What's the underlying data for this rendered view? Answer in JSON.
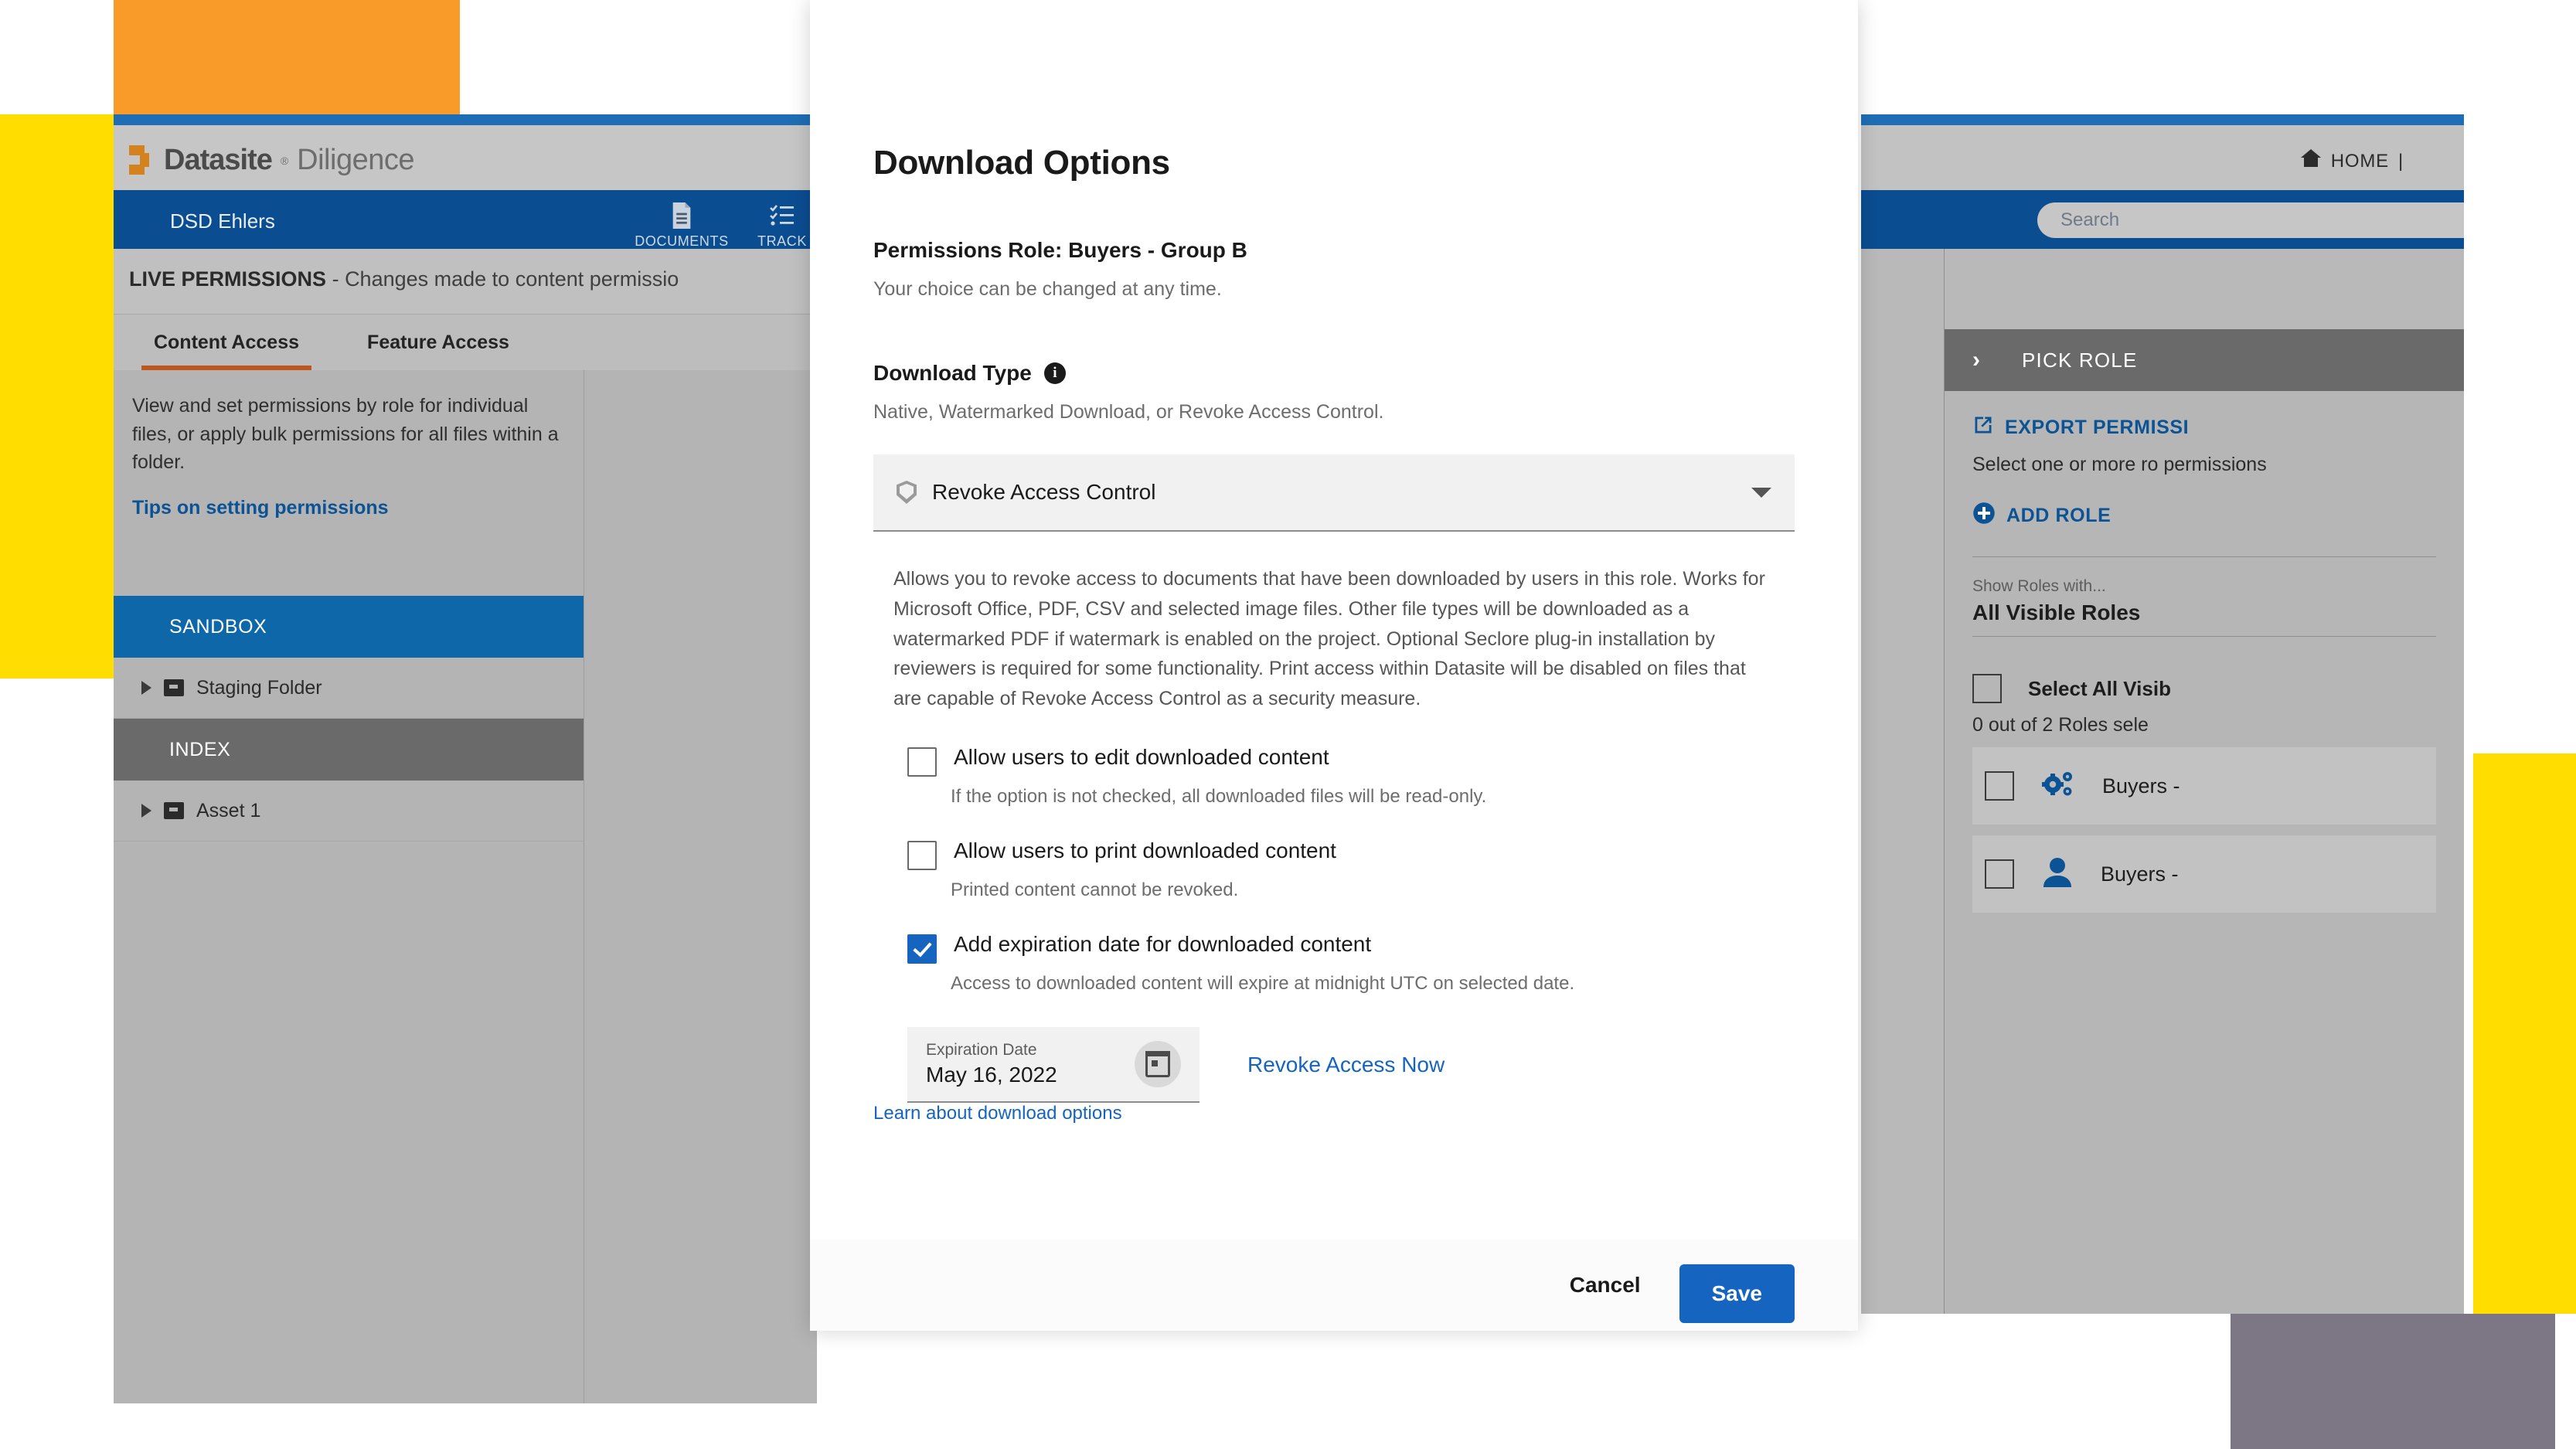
{
  "left_app": {
    "brand": {
      "bold": "Datasite",
      "reg": "Diligence",
      "trademark": "®"
    },
    "project_name": "DSD Ehlers",
    "nav": [
      {
        "label": "DOCUMENTS",
        "icon": "document-icon"
      },
      {
        "label": "TRACK",
        "icon": "checklist-icon"
      }
    ],
    "live_banner": {
      "title": "LIVE PERMISSIONS",
      "dash": " - ",
      "text": "Changes made to content permissio"
    },
    "tabs": [
      {
        "label": "Content Access",
        "active": true
      },
      {
        "label": "Feature Access",
        "active": false
      }
    ],
    "intro_text": "View and set permissions by role for individual files, or apply bulk permissions for all files within a folder.",
    "tips_link": "Tips on setting permissions",
    "tree": [
      {
        "type": "section",
        "label": "SANDBOX",
        "style": "blue"
      },
      {
        "type": "row",
        "label": "Staging Folder"
      },
      {
        "type": "section",
        "label": "INDEX",
        "style": "gray"
      },
      {
        "type": "row",
        "label": "Asset 1"
      }
    ]
  },
  "right_app": {
    "home_label": "HOME",
    "home_divider": "|",
    "search_placeholder": "Search",
    "pick_role_title": "PICK ROLE",
    "pick_role_chevron": "›",
    "export_permissions": "EXPORT PERMISSI",
    "select_text": "Select one or more ro permissions",
    "add_role": "ADD ROLE",
    "show_roles_label": "Show Roles with...",
    "visible_roles_value": "All Visible Roles",
    "select_all_label": "Select All Visib",
    "roles_count": "0 out of 2 Roles sele",
    "roles": [
      {
        "label": "Buyers -",
        "icon": "gears-icon"
      },
      {
        "label": "Buyers -",
        "icon": "person-icon"
      }
    ]
  },
  "modal": {
    "title": "Download Options",
    "permissions_role": "Permissions Role: Buyers - Group B",
    "permissions_sub": "Your choice can be changed at any time.",
    "download_type_label": "Download Type",
    "info_glyph": "i",
    "download_type_sub": "Native, Watermarked Download, or Revoke Access Control.",
    "selected_type": "Revoke Access Control",
    "description": "Allows you to revoke access to documents that have been downloaded by users in this role. Works for Microsoft Office, PDF, CSV and selected image files. Other file types will be downloaded as a watermarked PDF if watermark is enabled on the project. Optional Seclore plug-in installation by reviewers is required for some functionality. Print access within Datasite will be disabled on files that are capable of Revoke Access Control as a security measure.",
    "options": [
      {
        "label": "Allow users to edit downloaded content",
        "hint": "If the option is not checked, all downloaded files will be read-only.",
        "checked": false
      },
      {
        "label": "Allow users to print downloaded content",
        "hint": "Printed content cannot be revoked.",
        "checked": false
      },
      {
        "label": "Add expiration date for downloaded content",
        "hint": "Access to downloaded content will expire at midnight UTC on selected date.",
        "checked": true
      }
    ],
    "expiration_label": "Expiration Date",
    "expiration_value": "May 16, 2022",
    "revoke_now": "Revoke Access Now",
    "learn_link": "Learn about download options",
    "cancel_label": "Cancel",
    "save_label": "Save"
  },
  "colors": {
    "brand_orange": "#F89B29",
    "brand_yellow": "#FFDD00",
    "nav_blue": "#0B4D91",
    "accent_blue": "#1F6EB5",
    "link_blue": "#1565C0",
    "tab_underline": "#C0561B",
    "sandbox_blue": "#0E67A8"
  }
}
